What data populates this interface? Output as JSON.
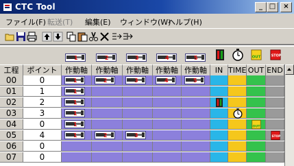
{
  "window": {
    "title": "CTC Tool"
  },
  "controls": {
    "minimize": "_",
    "maximize": "□",
    "close": "×"
  },
  "menu": [
    {
      "label": "ファイル(F)",
      "enabled": true
    },
    {
      "label": "転送(T)",
      "enabled": false
    },
    {
      "label": "編集(E)",
      "enabled": true
    },
    {
      "label": "ウィンドウ(W)",
      "enabled": true
    },
    {
      "label": "ヘルプ(H)",
      "enabled": true
    }
  ],
  "toolbar": [
    "open-icon",
    "save-icon",
    "print-icon",
    "move-up-icon",
    "move-down-icon",
    "copy-icon",
    "paste-icon",
    "cut-icon",
    "delete-icon",
    "insert-row-icon",
    "append-row-icon"
  ],
  "columns": [
    "工程",
    "ポイント",
    "作動軸",
    "作動軸",
    "作動軸",
    "作動軸",
    "作動軸",
    "IN",
    "TIME",
    "OUT",
    "END"
  ],
  "palette": {
    "actuators": [
      "1",
      "2",
      "3",
      "4",
      "5"
    ],
    "io": [
      "in-icon",
      "time-icon",
      "out-icon",
      "stop-icon"
    ],
    "labels": {
      "out": "OUT",
      "stop": "STOP"
    }
  },
  "colors": {
    "axis": "#8c80dc",
    "in": "#29b6e8",
    "time": "#f5c71c",
    "out": "#34c24c",
    "end": "#9a9a9a"
  },
  "rows": [
    {
      "step": "00",
      "point": "0",
      "axes": [
        "1",
        "2",
        "3",
        "4",
        "5"
      ],
      "in": false,
      "time": false,
      "out": false,
      "end": false
    },
    {
      "step": "01",
      "point": "1",
      "axes": [
        "1",
        "",
        "",
        "",
        ""
      ],
      "in": false,
      "time": false,
      "out": false,
      "end": false
    },
    {
      "step": "02",
      "point": "2",
      "axes": [
        "1",
        "",
        "",
        "",
        ""
      ],
      "in": true,
      "time": false,
      "out": false,
      "end": false
    },
    {
      "step": "03",
      "point": "3",
      "axes": [
        "1",
        "",
        "",
        "",
        ""
      ],
      "in": false,
      "time": true,
      "out": false,
      "end": false
    },
    {
      "step": "04",
      "point": "0",
      "axes": [
        "1",
        "",
        "",
        "",
        ""
      ],
      "in": false,
      "time": false,
      "out": true,
      "end": false
    },
    {
      "step": "05",
      "point": "4",
      "axes": [
        "1",
        "2",
        "3",
        "",
        ""
      ],
      "in": false,
      "time": false,
      "out": false,
      "end": true
    },
    {
      "step": "06",
      "point": "0",
      "axes": [
        "",
        "",
        "",
        "",
        ""
      ],
      "in": false,
      "time": false,
      "out": false,
      "end": false
    },
    {
      "step": "07",
      "point": "0",
      "axes": [
        "",
        "",
        "",
        "",
        ""
      ],
      "in": false,
      "time": false,
      "out": false,
      "end": false
    }
  ]
}
